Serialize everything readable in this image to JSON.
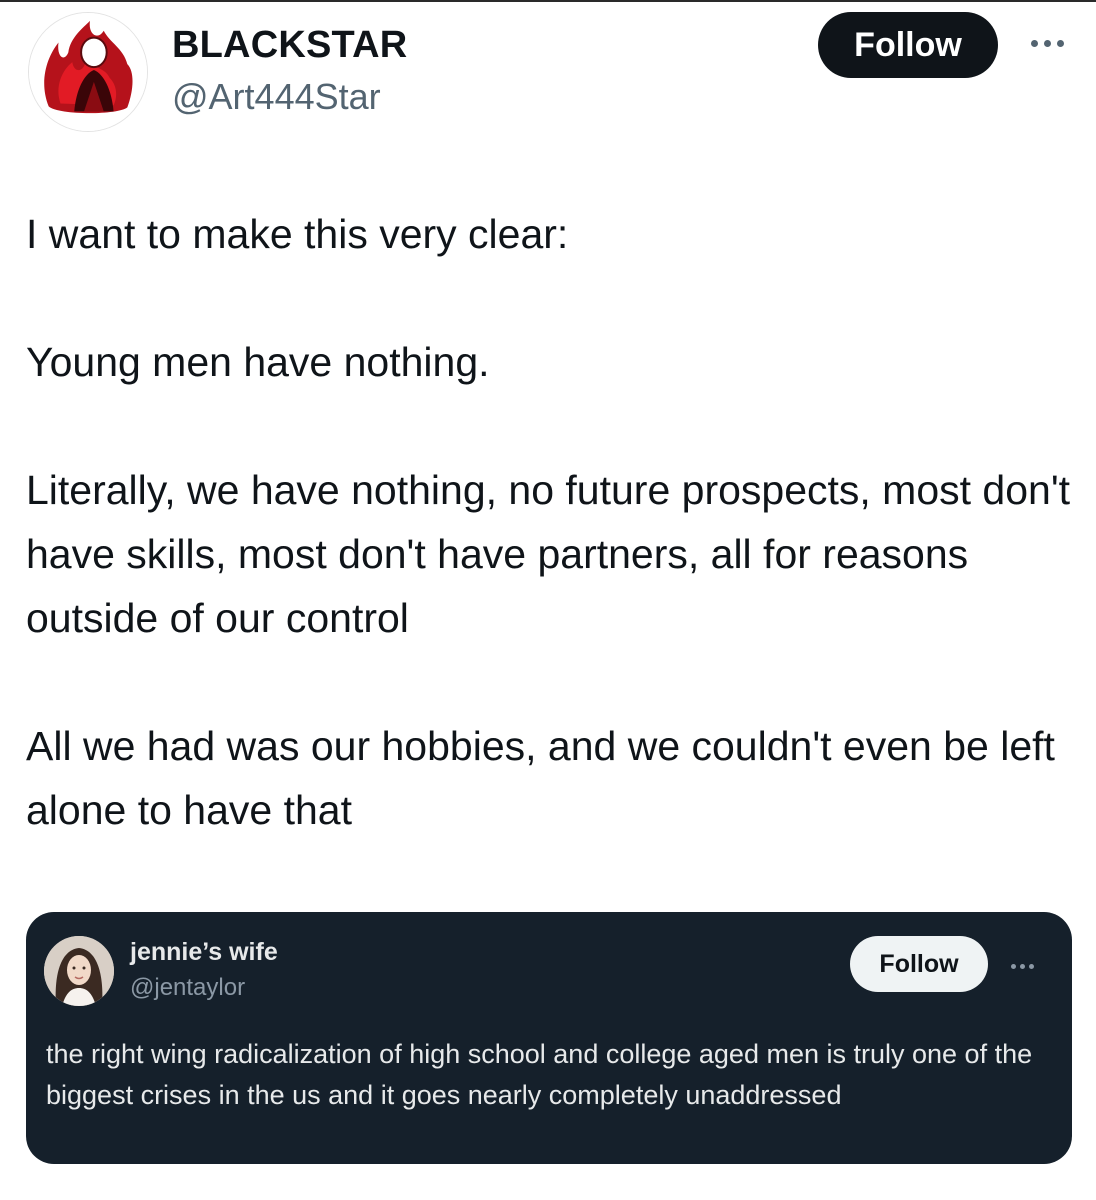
{
  "post": {
    "author": {
      "display_name": "BLACKSTAR",
      "handle": "@Art444Star",
      "avatar_icon": "red-figure-avatar"
    },
    "follow_label": "Follow",
    "more_icon": "more-horizontal-icon",
    "paragraphs": [
      "I want to make this very clear:",
      "Young men have nothing.",
      "Literally, we have nothing, no future prospects, most don't have skills, most don't have partners, all for reasons outside of our control",
      "All we had was our hobbies, and we couldn't even be left alone to have that"
    ]
  },
  "quoted_post": {
    "author": {
      "display_name": "jennie’s wife",
      "handle": "@jentaylor",
      "avatar_icon": "portrait-photo-avatar"
    },
    "follow_label": "Follow",
    "more_icon": "more-horizontal-icon",
    "text": "the right wing radicalization of high school and college aged men is truly one of the biggest crises in the us and it goes nearly completely unaddressed"
  },
  "colors": {
    "primary_text": "#0f1419",
    "secondary_text": "#536471",
    "quote_background": "#15202b",
    "quote_text": "#e7e9ea",
    "avatar_red": "#c0121c"
  }
}
